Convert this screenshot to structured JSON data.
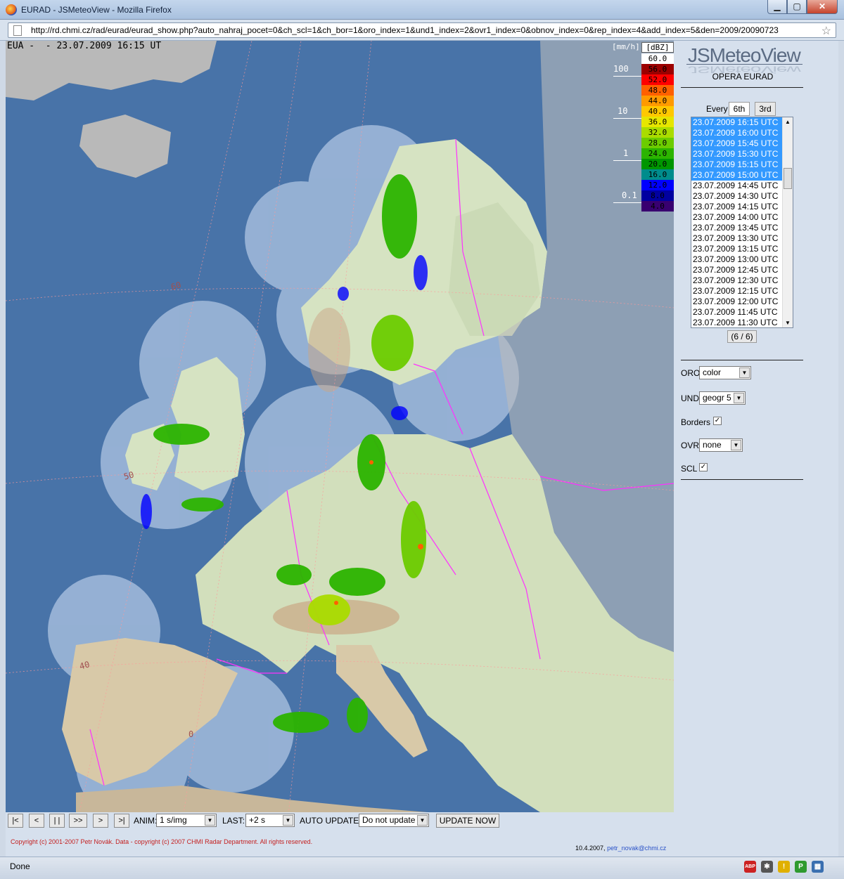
{
  "window": {
    "title": "EURAD - JSMeteoView - Mozilla Firefox",
    "min": "▁",
    "max": "▢",
    "close": "✕"
  },
  "browser": {
    "url": "http://rd.chmi.cz/rad/eurad/eurad_show.php?auto_nahraj_pocet=0&ch_scl=1&ch_bor=1&oro_index=1&und1_index=2&ovr1_index=0&obnov_index=0&rep_index=4&add_index=5&den=2009/20090723",
    "status": "Done"
  },
  "map": {
    "timestamp": "EUA -  - 23.07.2009 16:15 UT",
    "lat_labels": [
      "60",
      "50",
      "40"
    ],
    "lon_label": "0"
  },
  "scale": {
    "mm_unit": "[mm/h]",
    "dbz_unit": "[dBZ]",
    "mm_labels": [
      "100",
      "10",
      "1",
      "0.1"
    ],
    "levels": [
      {
        "label": "60.0",
        "color": "#ffffff"
      },
      {
        "label": "56.0",
        "color": "#9c0000"
      },
      {
        "label": "52.0",
        "color": "#ff0000"
      },
      {
        "label": "48.0",
        "color": "#ff6000"
      },
      {
        "label": "44.0",
        "color": "#ff9a00"
      },
      {
        "label": "40.0",
        "color": "#ffc800"
      },
      {
        "label": "36.0",
        "color": "#e6e600"
      },
      {
        "label": "32.0",
        "color": "#aadc00"
      },
      {
        "label": "28.0",
        "color": "#6ccc00"
      },
      {
        "label": "24.0",
        "color": "#2cb400"
      },
      {
        "label": "20.0",
        "color": "#009600"
      },
      {
        "label": "16.0",
        "color": "#008c8c"
      },
      {
        "label": "12.0",
        "color": "#0000ff"
      },
      {
        "label": "8.0",
        "color": "#0000a0"
      },
      {
        "label": "4.0",
        "color": "#380070"
      }
    ]
  },
  "sidebar": {
    "logo": "JSMeteoView",
    "subtitle": "OPERA EURAD",
    "every_label": "Every",
    "btn_6th": "6th",
    "btn_3rd": "3rd",
    "times": [
      {
        "t": "23.07.2009 16:15 UTC",
        "sel": true
      },
      {
        "t": "23.07.2009 16:00 UTC",
        "sel": true
      },
      {
        "t": "23.07.2009 15:45 UTC",
        "sel": true
      },
      {
        "t": "23.07.2009 15:30 UTC",
        "sel": true
      },
      {
        "t": "23.07.2009 15:15 UTC",
        "sel": true
      },
      {
        "t": "23.07.2009 15:00 UTC",
        "sel": true
      },
      {
        "t": "23.07.2009 14:45 UTC",
        "sel": false
      },
      {
        "t": "23.07.2009 14:30 UTC",
        "sel": false
      },
      {
        "t": "23.07.2009 14:15 UTC",
        "sel": false
      },
      {
        "t": "23.07.2009 14:00 UTC",
        "sel": false
      },
      {
        "t": "23.07.2009 13:45 UTC",
        "sel": false
      },
      {
        "t": "23.07.2009 13:30 UTC",
        "sel": false
      },
      {
        "t": "23.07.2009 13:15 UTC",
        "sel": false
      },
      {
        "t": "23.07.2009 13:00 UTC",
        "sel": false
      },
      {
        "t": "23.07.2009 12:45 UTC",
        "sel": false
      },
      {
        "t": "23.07.2009 12:30 UTC",
        "sel": false
      },
      {
        "t": "23.07.2009 12:15 UTC",
        "sel": false
      },
      {
        "t": "23.07.2009 12:00 UTC",
        "sel": false
      },
      {
        "t": "23.07.2009 11:45 UTC",
        "sel": false
      },
      {
        "t": "23.07.2009 11:30 UTC",
        "sel": false
      }
    ],
    "counter": "(6 / 6)",
    "oro_label": "ORO",
    "oro_value": "color",
    "und_label": "UND",
    "und_value": "geogr 5",
    "borders_label": "Borders",
    "borders_checked": "✓",
    "ovr_label": "OVR",
    "ovr_value": "none",
    "scl_label": "SCL",
    "scl_checked": "✓"
  },
  "controls": {
    "first": "|<",
    "prev": "<",
    "pause": "| |",
    "play": ">>",
    "next": ">",
    "last": ">|",
    "anim_label": "ANIM:",
    "anim_value": "1 s/img",
    "last_label": "LAST:",
    "last_value": "+2 s",
    "auto_label": "AUTO UPDATE",
    "auto_value": "Do not update",
    "update_now": "UPDATE NOW"
  },
  "footer": {
    "copyright": "Copyright (c) 2001-2007 Petr Novák. Data - copyright (c) 2007 CHMI Radar Department. All rights reserved.",
    "date": "10.4.2007,",
    "email": "petr_novak@chmi.cz"
  },
  "status_icons": [
    {
      "name": "adblock-icon",
      "text": "ABP",
      "color": "#cc2222"
    },
    {
      "name": "bug-icon",
      "text": "✱",
      "color": "#555555"
    },
    {
      "name": "warning-icon",
      "text": "!",
      "color": "#e0b000"
    },
    {
      "name": "p-green-icon",
      "text": "P",
      "color": "#2f9a2f"
    },
    {
      "name": "screenshot-icon",
      "text": "▦",
      "color": "#3a6fb0"
    }
  ]
}
